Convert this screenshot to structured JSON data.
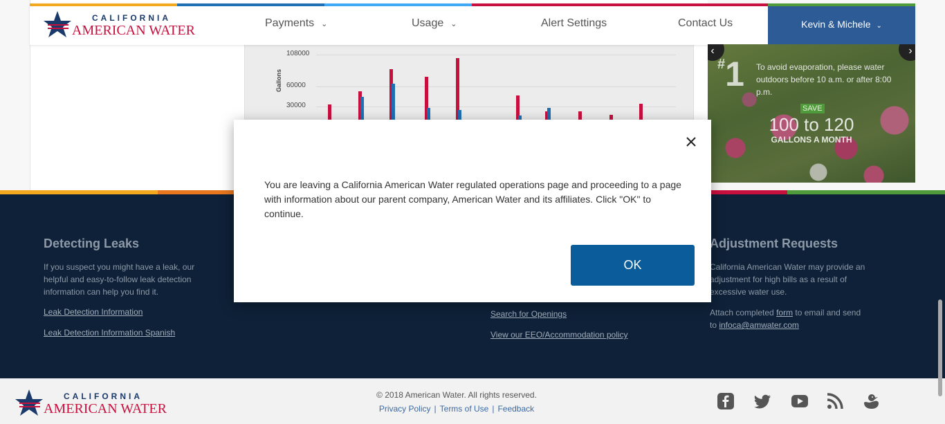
{
  "header": {
    "logo_top": "CALIFORNIA",
    "logo_bottom": "AMERICAN WATER",
    "nav": [
      {
        "label": "Payments"
      },
      {
        "label": "Usage"
      },
      {
        "label": "Alert Settings"
      },
      {
        "label": "Contact Us"
      }
    ],
    "user_name": "Kevin & Michele",
    "stripe_colors": [
      "#f4a81d",
      "#1e6fb3",
      "#3fa9f5",
      "#c8103e",
      "#4f9a3a"
    ]
  },
  "usage_chart": {
    "y_axis_label": "Gallons",
    "y_ticks": [
      "108000",
      "60000",
      "30000"
    ],
    "chart_data": {
      "type": "bar",
      "ylabel": "Gallons",
      "yticks": [
        30000,
        60000,
        108000
      ],
      "ylim": [
        0,
        108000
      ],
      "series": [
        {
          "color": "#c8103e",
          "values": [
            33000,
            53000,
            86000,
            75000,
            103000,
            47000,
            23000,
            23000,
            18000,
            34000
          ]
        },
        {
          "color": "#1e6fb3",
          "values": [
            0,
            45000,
            64000,
            28000,
            25000,
            16000,
            28000,
            0,
            0,
            0
          ]
        }
      ]
    }
  },
  "tip": {
    "number": "1",
    "hash": "#",
    "text": "To avoid evaporation, please water outdoors before 10 a.m. or after 8:00 p.m.",
    "save_label": "SAVE",
    "amount": "100 to 120",
    "unit": "GALLONS A MONTH"
  },
  "footer": {
    "leaks": {
      "heading": "Detecting Leaks",
      "body": "If you suspect you might have a leak, our helpful and easy-to-follow leak detection information can help you find it.",
      "link1": "Leak Detection Information",
      "link2": "Leak Detection Information Spanish"
    },
    "careers": {
      "link1": "Search for Openings",
      "link2": "View our EEO/Accommodation policy"
    },
    "adjustment": {
      "heading": "Adjustment Requests",
      "body": "California American Water may provide an adjustment for high bills as a result of excessive water use.",
      "attach_prefix": "Attach completed ",
      "form_link": "form",
      "attach_suffix": " to email and send to ",
      "email_link": "infoca@amwater.com"
    },
    "stripe_colors": [
      "#f4a81d",
      "#e8771e",
      "#1e6fb3",
      "#c8103e",
      "#4f9a3a"
    ]
  },
  "bottom": {
    "logo_top": "CALIFORNIA",
    "logo_bottom": "AMERICAN WATER",
    "copyright": "© 2018 American Water. All rights reserved.",
    "privacy": "Privacy Policy",
    "terms": "Terms of Use",
    "feedback": "Feedback",
    "separator": "|",
    "social_icons": [
      "facebook-icon",
      "twitter-icon",
      "youtube-icon",
      "rss-icon",
      "duck-icon"
    ]
  },
  "modal": {
    "message": "You are leaving a California American Water regulated operations page and proceeding to a page with information about our parent company, American Water and its affiliates. Click \"OK\" to continue.",
    "ok_label": "OK"
  }
}
